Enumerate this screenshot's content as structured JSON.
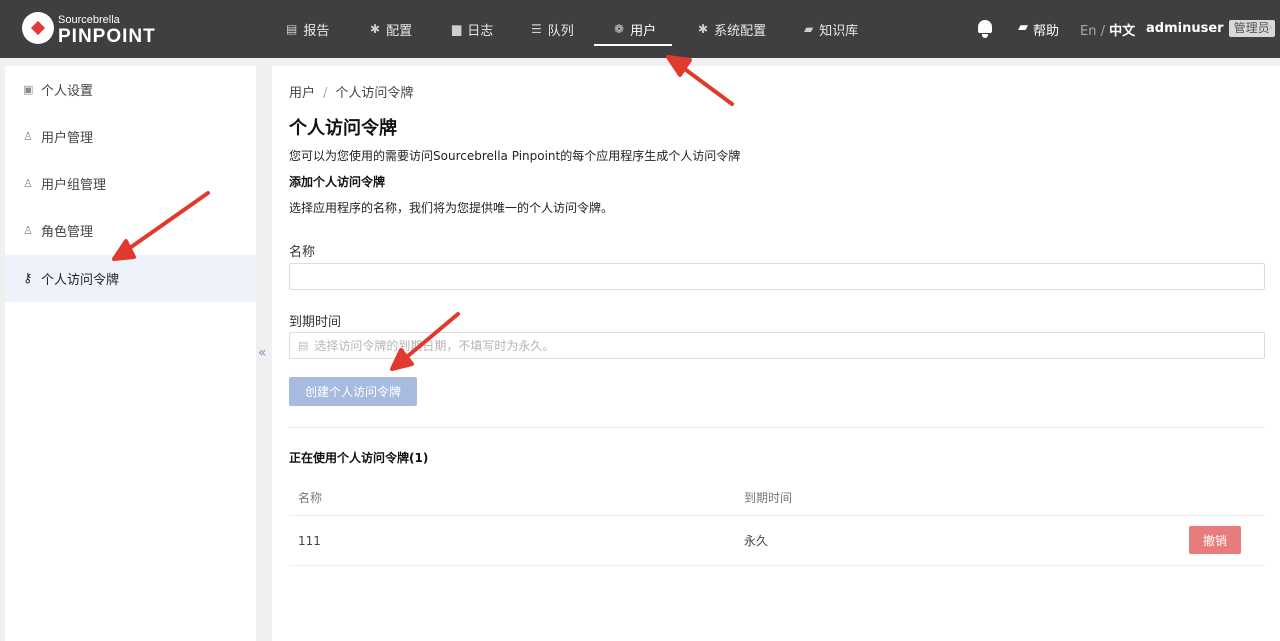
{
  "header": {
    "logo_small": "Sourcebrella",
    "logo_big": "PINPOINT",
    "nav": [
      {
        "label": "报告",
        "icon": "bar-chart-icon",
        "glyph": "▤"
      },
      {
        "label": "配置",
        "icon": "gear-icon",
        "glyph": "✱"
      },
      {
        "label": "日志",
        "icon": "document-icon",
        "glyph": "▆"
      },
      {
        "label": "队列",
        "icon": "queue-icon",
        "glyph": "☰"
      },
      {
        "label": "用户",
        "icon": "users-icon",
        "glyph": "❁"
      },
      {
        "label": "系统配置",
        "icon": "gear-icon",
        "glyph": "✱"
      },
      {
        "label": "知识库",
        "icon": "book-icon",
        "glyph": "▰"
      }
    ],
    "active_nav": "用户",
    "help_label": "帮助",
    "lang_en": "En",
    "lang_sep": "/",
    "lang_zh": "中文",
    "username": "adminuser",
    "role_badge": "管理员"
  },
  "sidebar": {
    "items": [
      {
        "label": "个人设置",
        "icon": "profile-icon",
        "glyph": "▣"
      },
      {
        "label": "用户管理",
        "icon": "user-icon",
        "glyph": "♙"
      },
      {
        "label": "用户组管理",
        "icon": "user-group-icon",
        "glyph": "♙"
      },
      {
        "label": "角色管理",
        "icon": "role-icon",
        "glyph": "♙"
      },
      {
        "label": "个人访问令牌",
        "icon": "key-icon",
        "glyph": "⚷"
      }
    ],
    "active_item": "个人访问令牌",
    "collapse_glyph": "«"
  },
  "main": {
    "breadcrumb": [
      "用户",
      "个人访问令牌"
    ],
    "breadcrumb_sep": "/",
    "title": "个人访问令牌",
    "description": "您可以为您使用的需要访问Sourcebrella Pinpoint的每个应用程序生成个人访问令牌",
    "add_heading": "添加个人访问令牌",
    "add_description": "选择应用程序的名称，我们将为您提供唯一的个人访问令牌。",
    "name_label": "名称",
    "name_value": "",
    "expiry_label": "到期时间",
    "expiry_placeholder": "选择访问令牌的到期日期，不填写时为永久。",
    "create_button": "创建个人访问令牌",
    "active_tokens_title": "正在使用个人访问令牌(1)",
    "table": {
      "columns": [
        "名称",
        "到期时间"
      ],
      "rows": [
        {
          "name": "111",
          "expiry": "永久",
          "action": "撤销"
        }
      ]
    }
  },
  "colors": {
    "header_bg": "#3f3f3f",
    "accent_disabled": "#a7badf",
    "revoke": "#e67c7c",
    "annotation": "#e03a2f"
  }
}
